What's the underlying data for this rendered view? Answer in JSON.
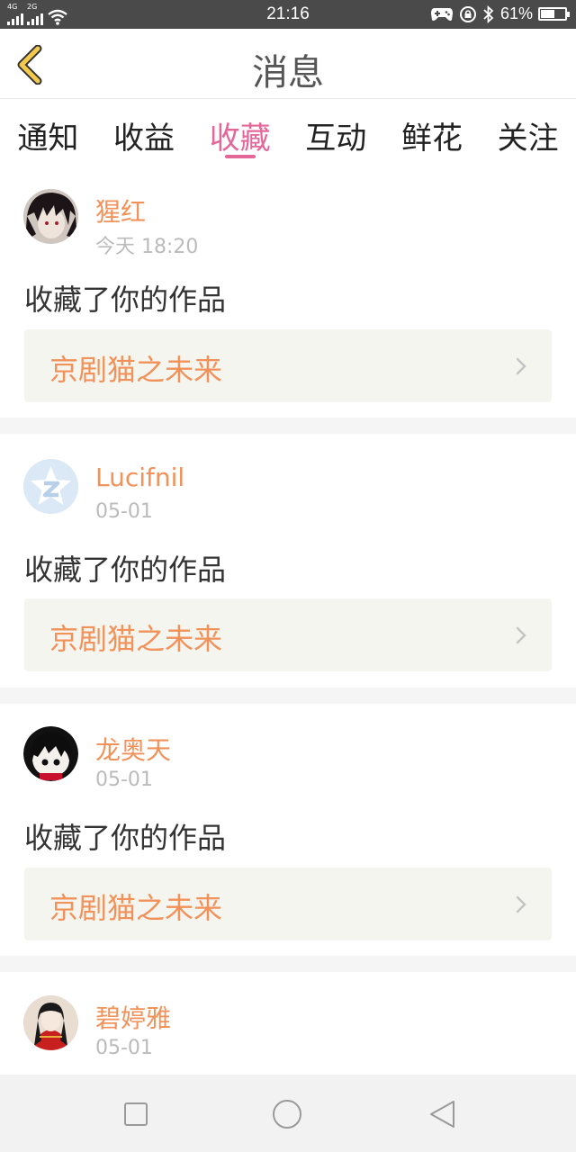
{
  "status_bar": {
    "network_label": "4G",
    "network_label_2": "2G",
    "time": "21:16",
    "battery_percent": "61%",
    "battery_level": 0.61
  },
  "header": {
    "title": "消息"
  },
  "tabs": [
    {
      "label": "通知"
    },
    {
      "label": "收益"
    },
    {
      "label": "收藏"
    },
    {
      "label": "互动"
    },
    {
      "label": "鲜花"
    },
    {
      "label": "关注"
    }
  ],
  "active_tab": "收藏",
  "colors": {
    "accent": "#e4679a",
    "name": "#f0925a",
    "back_icon": "#f2c94c"
  },
  "messages": [
    {
      "user": "猩红",
      "time": "今天 18:20",
      "action": "收藏了你的作品",
      "work": "京剧猫之未来",
      "avatar": "dark-hair-avatar"
    },
    {
      "user": "Lucifnil",
      "time": "05-01",
      "action": "收藏了你的作品",
      "work": "京剧猫之未来",
      "avatar": "qzone-star-avatar"
    },
    {
      "user": "龙奥天",
      "time": "05-01",
      "action": "收藏了你的作品",
      "work": "京剧猫之未来",
      "avatar": "cartoon-boy-avatar"
    },
    {
      "user": "碧婷雅",
      "time": "05-01",
      "action": "",
      "work": "",
      "avatar": "costume-girl-avatar"
    }
  ]
}
